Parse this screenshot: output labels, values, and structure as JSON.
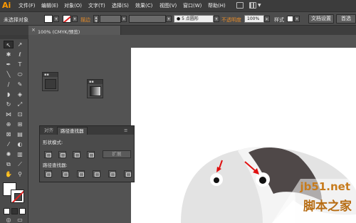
{
  "app": {
    "logo": "Ai",
    "menus": [
      "文件(F)",
      "编辑(E)",
      "对象(O)",
      "文字(T)",
      "选择(S)",
      "效果(C)",
      "视图(V)",
      "窗口(W)",
      "帮助(H)"
    ]
  },
  "control_bar": {
    "selection_status": "未选择对象",
    "stroke_label": "描边",
    "brush_value": "5 点圆形",
    "opacity_label": "不透明度",
    "opacity_value": "100%",
    "style_label": "样式",
    "doc_setup_button": "文档设置",
    "prefs_button": "首选"
  },
  "document_tab": {
    "close_glyph": "×",
    "title": "100% (CMYK/预览)"
  },
  "pathfinder_panel": {
    "tabs": [
      "对齐",
      "路径查找器"
    ],
    "shape_modes_label": "形状模式:",
    "expand_button": "扩展",
    "pathfinders_label": "路径查找器:"
  },
  "watermark": {
    "url": "jb51.net",
    "text": "脚本之家"
  },
  "colors": {
    "accent_orange": "#ff9a00",
    "stroke_none_red": "#e02020",
    "watermark_orange": "#c77b1c"
  },
  "icons": [
    "selection-tool-icon",
    "direct-selection-tool-icon",
    "pen-tool-icon",
    "type-tool-icon",
    "close-icon",
    "chevron-down-icon"
  ]
}
